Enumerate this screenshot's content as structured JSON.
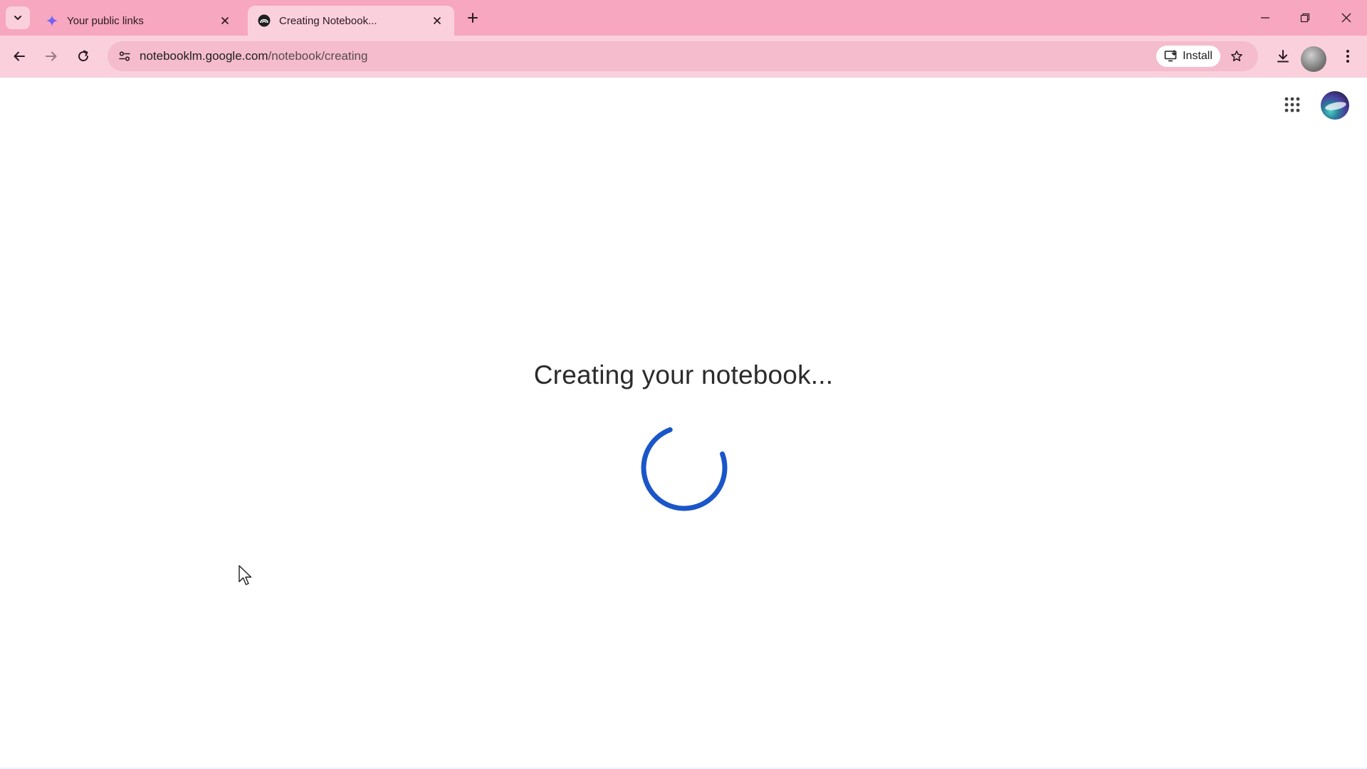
{
  "browser": {
    "tabs": [
      {
        "title": "Your public links",
        "active": false,
        "favicon": "gemini-sparkle-icon"
      },
      {
        "title": "Creating Notebook...",
        "active": true,
        "favicon": "notebooklm-icon"
      }
    ],
    "address": {
      "domain": "notebooklm.google.com",
      "path": "/notebook/creating"
    },
    "install_label": "Install"
  },
  "page": {
    "heading": "Creating your notebook..."
  },
  "colors": {
    "tabstrip": "#f7a7c0",
    "toolbar": "#fbd0dd",
    "spinner": "#1a56c8"
  }
}
